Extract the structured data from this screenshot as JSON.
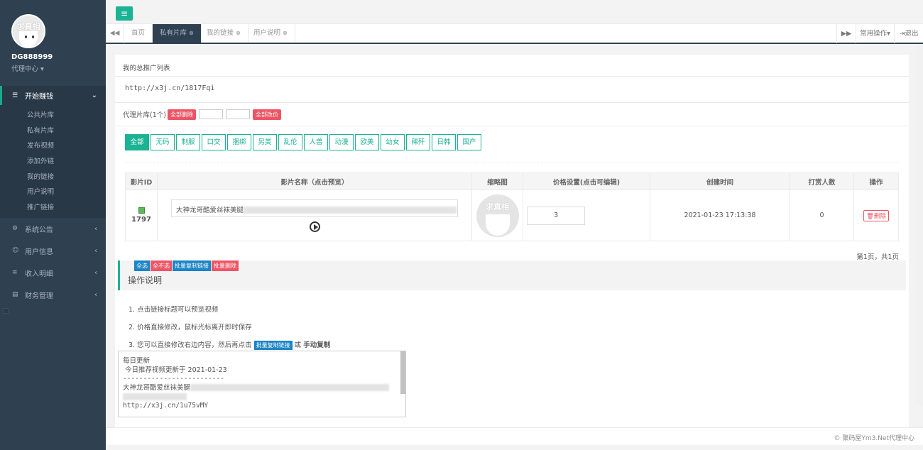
{
  "user": {
    "name": "DG888999",
    "role": "代理中心",
    "avatar_text": "求真相"
  },
  "sidebar": {
    "active_section": "开始赚钱",
    "sub_items": [
      "公共片库",
      "私有片库",
      "发布视频",
      "添加外链",
      "我的链接",
      "用户说明",
      "推广链接"
    ],
    "sections": [
      "系统公告",
      "用户信息",
      "收入明细",
      "财务管理"
    ]
  },
  "tabs": {
    "items": [
      {
        "label": "首页"
      },
      {
        "label": "私有片库",
        "active": true
      },
      {
        "label": "我的链接"
      },
      {
        "label": "用户说明"
      }
    ],
    "right": {
      "common_ops": "常用操作",
      "logout": "退出"
    }
  },
  "content": {
    "section_title": "我的总推广列表",
    "promo_link": "http://x3j.cn/1817Fqi",
    "library_label": "代理片库(1个)",
    "delete_all": "全部删除",
    "reprice_all": "全部改价",
    "categories": [
      "全部",
      "无码",
      "制服",
      "口交",
      "捆绑",
      "另类",
      "乱伦",
      "人兽",
      "动漫",
      "欧美",
      "幼女",
      "稀歼",
      "日韩",
      "国产"
    ],
    "table": {
      "headers": [
        "影片ID",
        "影片名称（点击预览）",
        "缩略图",
        "价格设置(点击可编辑)",
        "创建时间",
        "打赏人数",
        "操作"
      ],
      "rows": [
        {
          "id": "1797",
          "name": "大神龙哥酷爱丝袜美腿",
          "price": "3",
          "created": "2021-01-23 17:13:38",
          "tips": "0",
          "action": "删除",
          "thumb_text": "求真相"
        }
      ]
    },
    "pager": "第1页，共1页",
    "bulk": {
      "select_all": "全选",
      "select_none": "全不选",
      "copy_links": "批量复制链接",
      "delete": "批量删除"
    },
    "ops_title": "操作说明",
    "steps": {
      "s1": "1. 点击链接标题可以预览视频",
      "s2": "2. 价格直接修改，鼠标光标离开即时保存",
      "s3_pre": "3. 您可以直接修改右边内容，然后再点击",
      "s3_btn": "批量复制链接",
      "s3_mid": "或",
      "s3_bold": "手动复制"
    },
    "textarea": {
      "line1": "每日更新",
      "line2": "今日推荐视频更新于 2021-01-23",
      "line3": "-------------------------",
      "line4": "大神龙哥酷爱丝袜美腿",
      "line5": "http://x3j.cn/1u75vMY"
    }
  },
  "footer": "© 聚码屋Ym3.Net代理中心",
  "colors": {
    "sidebar": "#2f4050",
    "accent": "#1ab394",
    "danger": "#ed5565",
    "primary": "#1c84c6"
  }
}
